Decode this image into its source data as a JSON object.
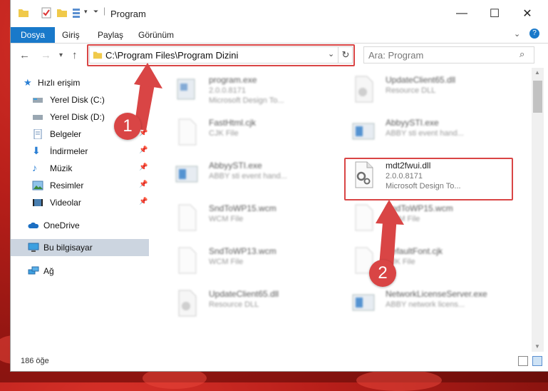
{
  "window": {
    "title": "Program"
  },
  "ribbon": {
    "tabs": [
      {
        "label": "Dosya"
      },
      {
        "label": "Giriş"
      },
      {
        "label": "Paylaş"
      },
      {
        "label": "Görünüm"
      }
    ]
  },
  "nav": {
    "address": "C:\\Program Files\\Program Dizini",
    "search_placeholder": "Ara: Program"
  },
  "sidebar": {
    "items": [
      {
        "label": "Hızlı erişim"
      },
      {
        "label": "Yerel Disk (C:)"
      },
      {
        "label": "Yerel Disk (D:)"
      },
      {
        "label": "Belgeler"
      },
      {
        "label": "İndirmeler"
      },
      {
        "label": "Müzik"
      },
      {
        "label": "Resimler"
      },
      {
        "label": "Videolar"
      },
      {
        "label": "OneDrive"
      },
      {
        "label": "Bu bilgisayar"
      },
      {
        "label": "Ağ"
      }
    ]
  },
  "files": [
    {
      "name": "program.exe",
      "line2": "2.0.0.8171",
      "line3": "Microsoft Design To..."
    },
    {
      "name": "UpdateClient65.dll",
      "line2": "Resource DLL",
      "line3": ""
    },
    {
      "name": "FastHtml.cjk",
      "line2": "CJK File",
      "line3": ""
    },
    {
      "name": "AbbyySTI.exe",
      "line2": "ABBY sti event hand...",
      "line3": ""
    },
    {
      "name": "AbbyySTI.exe",
      "line2": "ABBY sti event hand...",
      "line3": ""
    },
    {
      "name": "mdt2fwui.dll",
      "line2": "2.0.0.8171",
      "line3": "Microsoft Design To..."
    },
    {
      "name": "SndToWP15.wcm",
      "line2": "WCM File",
      "line3": ""
    },
    {
      "name": "SndToWP15.wcm",
      "line2": "WCM File",
      "line3": ""
    },
    {
      "name": "SndToWP13.wcm",
      "line2": "WCM File",
      "line3": ""
    },
    {
      "name": "DefaultFont.cjk",
      "line2": "CJK File",
      "line3": ""
    },
    {
      "name": "UpdateClient65.dll",
      "line2": "Resource DLL",
      "line3": ""
    },
    {
      "name": "NetworkLicenseServer.exe",
      "line2": "ABBY network licens...",
      "line3": ""
    }
  ],
  "status": {
    "count": "186 öğe"
  },
  "annotations": {
    "step1": "1",
    "step2": "2"
  },
  "colors": {
    "accent": "#1979ca",
    "highlight": "#d94545",
    "selected": "#ccd5e0"
  }
}
